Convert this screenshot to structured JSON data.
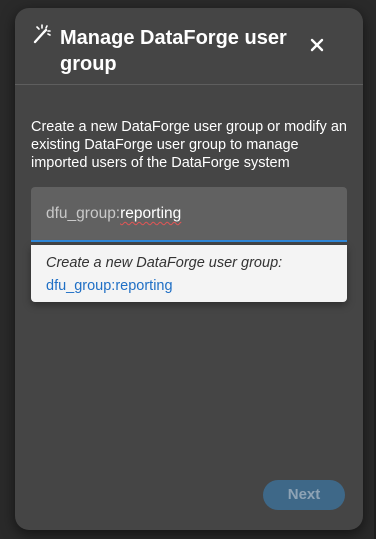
{
  "dialog": {
    "title": "Manage DataForge user group",
    "description": "Create a new DataForge user group or modify an existing DataForge user group to manage imported users of the DataForge system",
    "icons": {
      "title_icon": "magic-wand-icon",
      "close_icon": "close-icon"
    }
  },
  "group_input": {
    "prefix": "dfu_group:",
    "value": "reporting",
    "spellcheck_flagged": true
  },
  "suggestion": {
    "label": "Create a new DataForge user group:",
    "value": "dfu_group:reporting"
  },
  "footer": {
    "next_label": "Next",
    "next_enabled": false
  },
  "colors": {
    "dialog_background": "#454545",
    "input_underline": "#2f88d9",
    "link": "#1f6fc5",
    "next_button": "#3e6888"
  }
}
